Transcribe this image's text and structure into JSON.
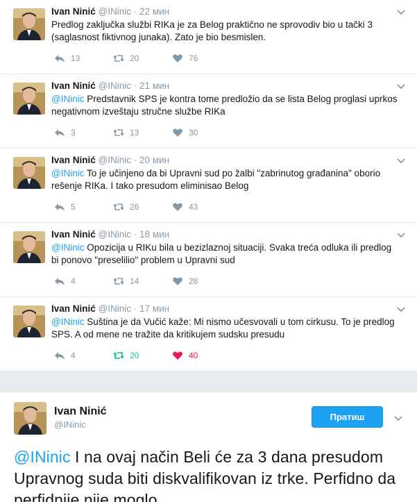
{
  "tweets": [
    {
      "name": "Ivan Ninić",
      "handle": "@INinic",
      "sep": "·",
      "time": "22 мин",
      "mention": "",
      "text": "Predlog zaključka službi RIKa je za Belog praktično ne sprovodiv bio u tački 3 (saglasnost fiktivnog junaka). Zato je bio besmislen.",
      "replies": "13",
      "retweets": "20",
      "likes": "76"
    },
    {
      "name": "Ivan Ninić",
      "handle": "@INinic",
      "sep": "·",
      "time": "21 мин",
      "mention": "@INinic",
      "text": " Predstavnik SPS je kontra tome predložio da se lista Belog proglasi uprkos negativnom izveštaju stručne službe RIKa",
      "replies": "3",
      "retweets": "13",
      "likes": "30"
    },
    {
      "name": "Ivan Ninić",
      "handle": "@INinic",
      "sep": "·",
      "time": "20 мин",
      "mention": "@INinic",
      "text": " To je učinjeno da bi Upravni sud po žalbi \"zabrinutog građanina\" oborio rešenje RIKa. I tako presudom eliminisao Belog",
      "replies": "5",
      "retweets": "26",
      "likes": "43"
    },
    {
      "name": "Ivan Ninić",
      "handle": "@INinic",
      "sep": "·",
      "time": "18 мин",
      "mention": "@INinic",
      "text": " Opozicija u RIKu bila u bezizlaznoj situaciji. Svaka treća odluka ili predlog bi ponovo \"preselilio\" problem u Upravni sud",
      "replies": "4",
      "retweets": "14",
      "likes": "28"
    },
    {
      "name": "Ivan Ninić",
      "handle": "@INinic",
      "sep": "·",
      "time": "17 мин",
      "mention": "@INinic",
      "text": " Suština je da Vučić kaže: Mi nismo učesvovali u tom cirkusu. To je predlog SPS. A od mene ne tražite da kritikujem sudsku presudu",
      "replies": "4",
      "retweets": "20",
      "likes": "40"
    }
  ],
  "main_tweet": {
    "name": "Ivan Ninić",
    "handle": "@INinic",
    "follow_label": "Пратиш",
    "mention": "@INinic",
    "text": " I na ovaj način Beli će za 3 dana presudom Upravnog suda biti diskvalifikovan iz trke. Perfidno da perfidnije nije moglo"
  },
  "colors": {
    "accent": "#1da1f2",
    "retweet_active": "#19cf86",
    "like_active": "#e81c4f",
    "muted": "#8899a6"
  },
  "icons": [
    "reply-icon",
    "retweet-icon",
    "like-icon",
    "chevron-down-icon",
    "avatar"
  ]
}
